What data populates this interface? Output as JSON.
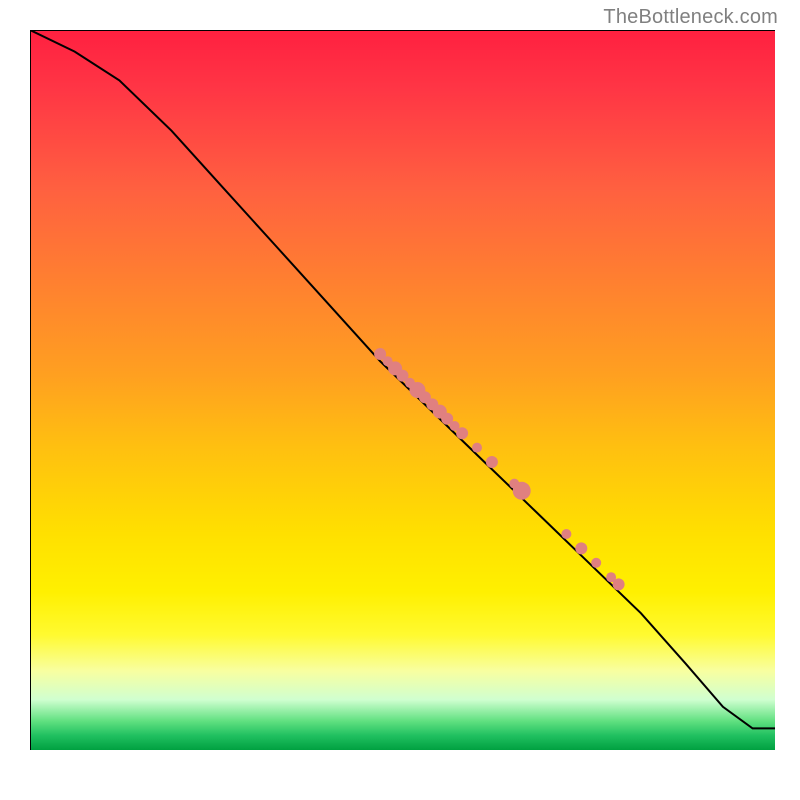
{
  "attribution": "TheBottleneck.com",
  "colors": {
    "curve": "#000000",
    "dots": "#e08080",
    "attribution_text": "#808080"
  },
  "chart_data": {
    "type": "line",
    "title": "",
    "xlabel": "",
    "ylabel": "",
    "xlim": [
      0,
      100
    ],
    "ylim": [
      0,
      100
    ],
    "grid": false,
    "legend": false,
    "series": [
      {
        "name": "curve",
        "x": [
          0,
          6,
          12,
          19,
          26,
          33,
          40,
          47,
          54,
          61,
          68,
          75,
          82,
          88,
          93,
          97,
          100
        ],
        "y": [
          100,
          97,
          93,
          86,
          78,
          70,
          62,
          54,
          47,
          40,
          33,
          26,
          19,
          12,
          6,
          3,
          3
        ]
      }
    ],
    "scatter_points": [
      {
        "x": 47,
        "y": 55,
        "r": 6
      },
      {
        "x": 48,
        "y": 54,
        "r": 5
      },
      {
        "x": 49,
        "y": 53,
        "r": 7
      },
      {
        "x": 50,
        "y": 52,
        "r": 6
      },
      {
        "x": 51,
        "y": 51,
        "r": 5
      },
      {
        "x": 52,
        "y": 50,
        "r": 8
      },
      {
        "x": 53,
        "y": 49,
        "r": 6
      },
      {
        "x": 54,
        "y": 48,
        "r": 6
      },
      {
        "x": 55,
        "y": 47,
        "r": 7
      },
      {
        "x": 56,
        "y": 46,
        "r": 6
      },
      {
        "x": 57,
        "y": 45,
        "r": 5
      },
      {
        "x": 58,
        "y": 44,
        "r": 6
      },
      {
        "x": 60,
        "y": 42,
        "r": 5
      },
      {
        "x": 62,
        "y": 40,
        "r": 6
      },
      {
        "x": 65,
        "y": 37,
        "r": 5
      },
      {
        "x": 66,
        "y": 36,
        "r": 9
      },
      {
        "x": 72,
        "y": 30,
        "r": 5
      },
      {
        "x": 74,
        "y": 28,
        "r": 6
      },
      {
        "x": 76,
        "y": 26,
        "r": 5
      },
      {
        "x": 78,
        "y": 24,
        "r": 5
      },
      {
        "x": 79,
        "y": 23,
        "r": 6
      }
    ]
  }
}
